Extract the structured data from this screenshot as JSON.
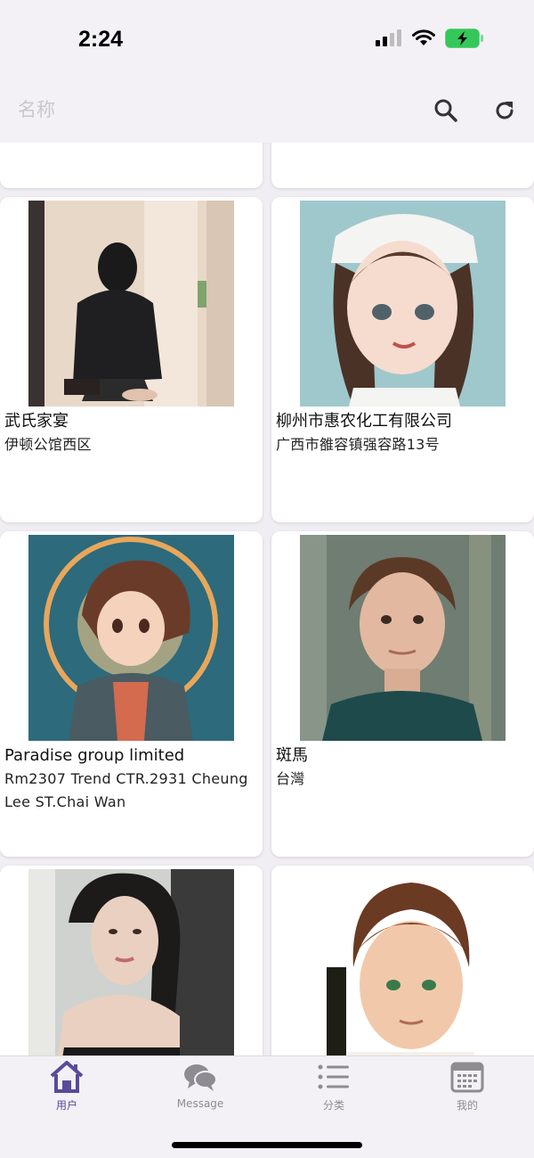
{
  "status_bar": {
    "time": "2:24"
  },
  "app_bar": {
    "search_placeholder": "名称"
  },
  "cards": [
    {
      "title": "武氏家宴",
      "subtitle": "伊顿公馆西区"
    },
    {
      "title": "柳州市惠农化工有限公司",
      "subtitle": "广西市雒容镇强容路13号"
    },
    {
      "title": "Paradise group limited",
      "subtitle": "Rm2307 Trend CTR.2931 Cheung Lee ST.Chai Wan"
    },
    {
      "title": "斑馬",
      "subtitle": "台灣"
    }
  ],
  "nav": {
    "items": [
      {
        "label": "用户",
        "icon": "home-icon",
        "active": true
      },
      {
        "label": "Message",
        "icon": "chat-bubbles-icon",
        "active": false
      },
      {
        "label": "分类",
        "icon": "list-icon",
        "active": false
      },
      {
        "label": "我的",
        "icon": "calendar-icon",
        "active": false
      }
    ]
  },
  "colors": {
    "accent": "#5a4a9a",
    "bar_background": "#f3f1f6",
    "page_background": "#f0eef3",
    "battery_green": "#34c759"
  }
}
